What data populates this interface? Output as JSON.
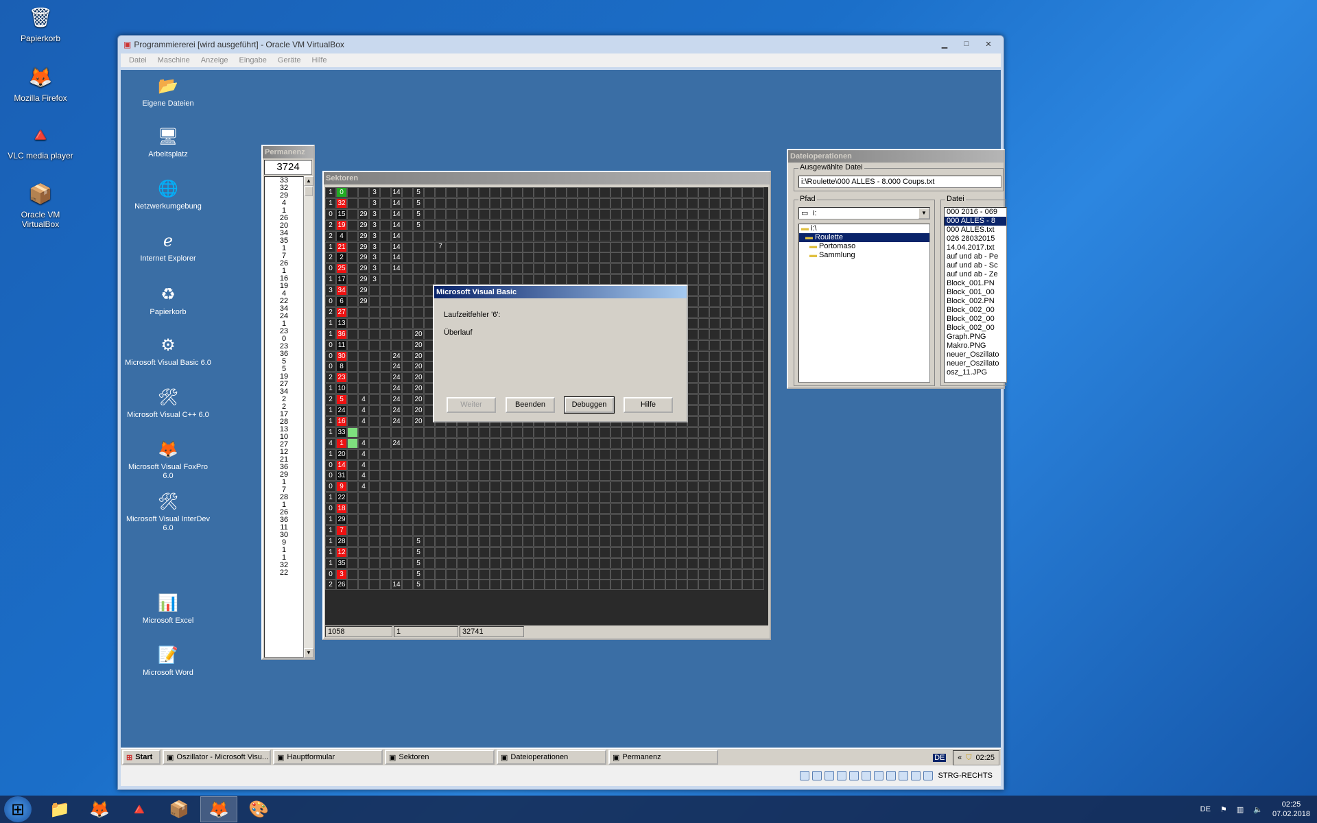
{
  "host_desktop": {
    "icons": [
      {
        "label": "Papierkorb",
        "icon": "recycle-bin-icon",
        "glyph": "🗑"
      },
      {
        "label": "Mozilla Firefox",
        "icon": "firefox-icon",
        "glyph": "🦊"
      },
      {
        "label": "VLC media player",
        "icon": "vlc-icon",
        "glyph": "🔺"
      },
      {
        "label": "Oracle VM VirtualBox",
        "icon": "virtualbox-icon",
        "glyph": "📦"
      }
    ]
  },
  "vbox": {
    "title": "Programmiererei [wird ausgeführt] - Oracle VM VirtualBox",
    "menu": [
      "Datei",
      "Maschine",
      "Anzeige",
      "Eingabe",
      "Geräte",
      "Hilfe"
    ],
    "status_text": "STRG-RECHTS"
  },
  "guest_desktop": {
    "icons": [
      {
        "label": "Eigene Dateien",
        "glyph": "📂"
      },
      {
        "label": "Arbeitsplatz",
        "glyph": "🖥"
      },
      {
        "label": "Netzwerkumgebung",
        "glyph": "🌐"
      },
      {
        "label": "Internet Explorer",
        "glyph": "ℯ"
      },
      {
        "label": "Papierkorb",
        "glyph": "♻"
      },
      {
        "label": "Microsoft Visual Basic 6.0",
        "glyph": "⚙"
      },
      {
        "label": "Microsoft Visual C++ 6.0",
        "glyph": "🛠"
      },
      {
        "label": "Microsoft Visual FoxPro 6.0",
        "glyph": "🦊"
      },
      {
        "label": "Microsoft Visual InterDev 6.0",
        "glyph": "🛠"
      },
      {
        "label": "Microsoft Excel",
        "glyph": "📊"
      },
      {
        "label": "Microsoft Word",
        "glyph": "📝"
      }
    ]
  },
  "permanenz": {
    "title": "Permanenz",
    "count": "3724",
    "numbers": [
      "33",
      "32",
      "29",
      "4",
      "1",
      "26",
      "20",
      "34",
      "35",
      "1",
      "7",
      "26",
      "1",
      "16",
      "19",
      "4",
      "22",
      "34",
      "24",
      "1",
      "23",
      "0",
      "23",
      "36",
      "5",
      "5",
      "19",
      "27",
      "34",
      "2",
      "2",
      "17",
      "28",
      "13",
      "10",
      "27",
      "12",
      "21",
      "36",
      "29",
      "1",
      "7",
      "28",
      "1",
      "26",
      "36",
      "11",
      "30",
      "9",
      "1",
      "1",
      "32",
      "22"
    ]
  },
  "sektoren": {
    "title": "Sektoren",
    "status": [
      "1058",
      "1",
      "32741"
    ],
    "rows": [
      {
        "c": "1",
        "n": "0",
        "col": "green",
        "v": [
          [
            "",
            "3",
            "14",
            "5"
          ]
        ]
      },
      {
        "c": "1",
        "n": "32",
        "col": "red",
        "v": [
          [
            "",
            "3",
            "14",
            "5"
          ]
        ]
      },
      {
        "c": "0",
        "n": "15",
        "col": "black",
        "v": [
          [
            "29",
            "3",
            "14",
            "5"
          ]
        ]
      },
      {
        "c": "2",
        "n": "19",
        "col": "red",
        "v": [
          [
            "29",
            "3",
            "14",
            "5"
          ]
        ]
      },
      {
        "c": "2",
        "n": "4",
        "col": "black",
        "v": [
          [
            "29",
            "3",
            "14",
            ""
          ]
        ]
      },
      {
        "c": "1",
        "n": "21",
        "col": "red",
        "v": [
          [
            "29",
            "3",
            "14",
            ""
          ]
        ]
      },
      {
        "c": "2",
        "n": "2",
        "col": "black",
        "v": [
          [
            "29",
            "3",
            "14",
            ""
          ]
        ]
      },
      {
        "c": "0",
        "n": "25",
        "col": "red",
        "v": [
          [
            "29",
            "3",
            "14",
            ""
          ]
        ]
      },
      {
        "c": "1",
        "n": "17",
        "col": "black",
        "v": [
          [
            "29",
            "3",
            "",
            ""
          ]
        ]
      },
      {
        "c": "3",
        "n": "34",
        "col": "red",
        "v": [
          [
            "29",
            "",
            "",
            ""
          ]
        ]
      },
      {
        "c": "0",
        "n": "6",
        "col": "black",
        "v": [
          [
            "29",
            "",
            "",
            ""
          ]
        ]
      },
      {
        "c": "2",
        "n": "27",
        "col": "red",
        "v": [
          [
            "",
            "",
            "",
            ""
          ]
        ]
      },
      {
        "c": "1",
        "n": "13",
        "col": "black",
        "v": [
          [
            "",
            "",
            "",
            ""
          ]
        ]
      },
      {
        "c": "1",
        "n": "36",
        "col": "red",
        "v": [
          [
            "",
            "",
            "",
            "20"
          ]
        ]
      },
      {
        "c": "0",
        "n": "11",
        "col": "black",
        "v": [
          [
            "",
            "",
            "",
            "20"
          ]
        ]
      },
      {
        "c": "0",
        "n": "30",
        "col": "red",
        "v": [
          [
            "",
            "",
            "24",
            "20"
          ]
        ]
      },
      {
        "c": "0",
        "n": "8",
        "col": "black",
        "v": [
          [
            "",
            "",
            "24",
            "20"
          ]
        ]
      },
      {
        "c": "2",
        "n": "23",
        "col": "red",
        "v": [
          [
            "",
            "",
            "24",
            "20"
          ]
        ]
      },
      {
        "c": "1",
        "n": "10",
        "col": "black",
        "v": [
          [
            "",
            "",
            "24",
            "20"
          ]
        ]
      },
      {
        "c": "2",
        "n": "5",
        "col": "red",
        "v": [
          [
            "4",
            "",
            "24",
            "20"
          ]
        ]
      },
      {
        "c": "1",
        "n": "24",
        "col": "black",
        "v": [
          [
            "4",
            "",
            "24",
            "20"
          ]
        ]
      },
      {
        "c": "1",
        "n": "16",
        "col": "red",
        "v": [
          [
            "4",
            "",
            "24",
            "20"
          ]
        ]
      },
      {
        "c": "1",
        "n": "33",
        "col": "black",
        "v": [
          [
            "",
            "",
            "",
            ""
          ]
        ]
      },
      {
        "c": "4",
        "n": "1",
        "col": "red",
        "v": [
          [
            "4",
            "",
            "24",
            ""
          ]
        ]
      },
      {
        "c": "1",
        "n": "20",
        "col": "black",
        "v": [
          [
            "4",
            "",
            "",
            ""
          ]
        ]
      },
      {
        "c": "0",
        "n": "14",
        "col": "red",
        "v": [
          [
            "4",
            "",
            "",
            ""
          ]
        ]
      },
      {
        "c": "0",
        "n": "31",
        "col": "black",
        "v": [
          [
            "4",
            "",
            "",
            ""
          ]
        ]
      },
      {
        "c": "0",
        "n": "9",
        "col": "red",
        "v": [
          [
            "4",
            "",
            "",
            ""
          ]
        ]
      },
      {
        "c": "1",
        "n": "22",
        "col": "black",
        "v": [
          [
            "",
            "",
            "",
            ""
          ]
        ]
      },
      {
        "c": "0",
        "n": "18",
        "col": "red",
        "v": [
          [
            "",
            "",
            "",
            ""
          ]
        ]
      },
      {
        "c": "1",
        "n": "29",
        "col": "black",
        "v": [
          [
            "",
            "",
            "",
            ""
          ]
        ]
      },
      {
        "c": "1",
        "n": "7",
        "col": "red",
        "v": [
          [
            "",
            "",
            "",
            ""
          ]
        ]
      },
      {
        "c": "1",
        "n": "28",
        "col": "black",
        "v": [
          [
            "",
            "",
            "",
            "5"
          ]
        ]
      },
      {
        "c": "1",
        "n": "12",
        "col": "red",
        "v": [
          [
            "",
            "",
            "",
            "5"
          ]
        ]
      },
      {
        "c": "1",
        "n": "35",
        "col": "black",
        "v": [
          [
            "",
            "",
            "",
            "5"
          ]
        ]
      },
      {
        "c": "0",
        "n": "3",
        "col": "red",
        "v": [
          [
            "",
            "",
            "",
            "5"
          ]
        ]
      },
      {
        "c": "2",
        "n": "26",
        "col": "black",
        "v": [
          [
            "",
            "",
            "14",
            "5"
          ]
        ]
      }
    ],
    "extra_7": "7"
  },
  "dialog": {
    "title": "Microsoft Visual Basic",
    "line1": "Laufzeitfehler '6':",
    "line2": "Überlauf",
    "buttons": {
      "weiter": "Weiter",
      "beenden": "Beenden",
      "debuggen": "Debuggen",
      "hilfe": "Hilfe"
    }
  },
  "datei": {
    "title": "Dateioperationen",
    "selected_label": "Ausgewählte Datei",
    "selected_value": "i:\\Roulette\\000 ALLES - 8.000 Coups.txt",
    "pfad_label": "Pfad",
    "drive": "i:",
    "tree": [
      "i:\\",
      "Roulette",
      "Portomaso",
      "Sammlung"
    ],
    "datei_label": "Datei",
    "files": [
      "000 2016 - 069",
      "000 ALLES - 8",
      "000 ALLES.txt",
      "026 28032015",
      "14.04.2017.txt",
      "auf und ab - Pe",
      "auf und ab - Sc",
      "auf und ab - Ze",
      "Block_001.PN",
      "Block_001_00",
      "Block_002.PN",
      "Block_002_00",
      "Block_002_00",
      "Block_002_00",
      "Graph.PNG",
      "Makro.PNG",
      "neuer_Oszillato",
      "neuer_Oszillato",
      "osz_11.JPG"
    ]
  },
  "guest_taskbar": {
    "start": "Start",
    "items": [
      "Oszillator - Microsoft Visu...",
      "Hauptformular",
      "Sektoren",
      "Dateioperationen",
      "Permanenz"
    ],
    "lang": "DE",
    "time": "02:25"
  },
  "host_taskbar": {
    "lang": "DE",
    "time": "02:25",
    "date": "07.02.2018"
  }
}
